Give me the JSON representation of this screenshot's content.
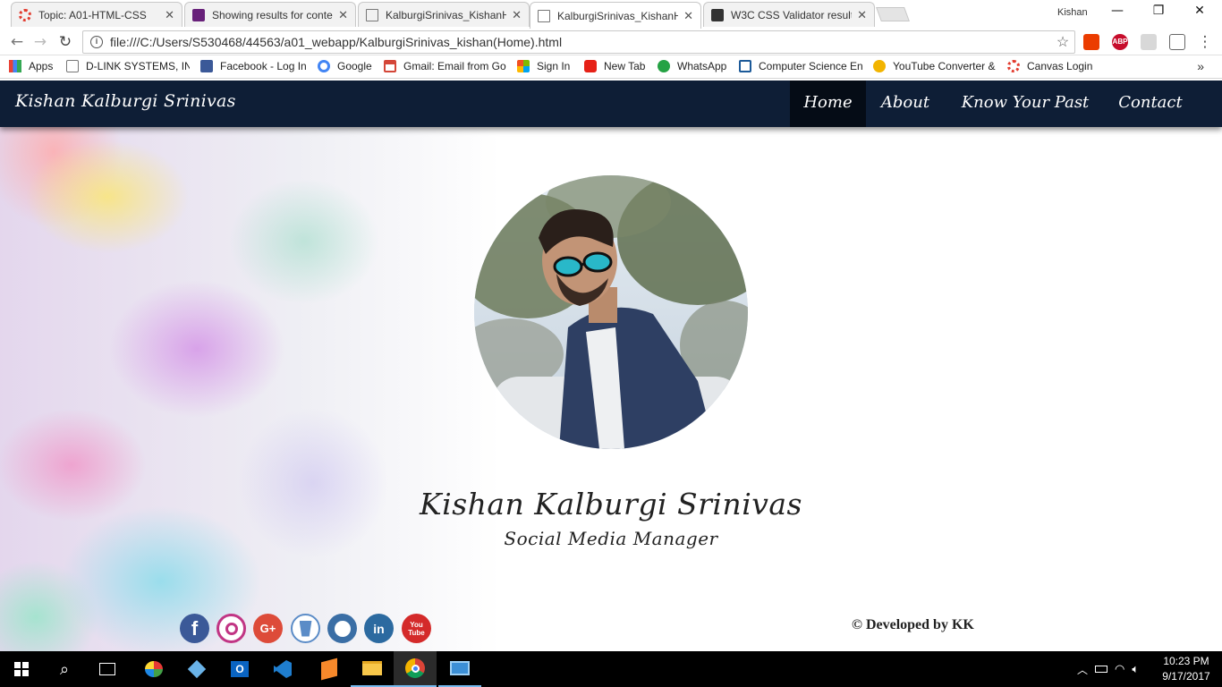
{
  "browser": {
    "tabs": [
      {
        "title": "Topic: A01-HTML-CSS",
        "icon": "canvas-icon",
        "active": false
      },
      {
        "title": "Showing results for conte",
        "icon": "vs-icon",
        "active": false
      },
      {
        "title": "KalburgiSrinivas_KishanH",
        "icon": "page-icon",
        "active": false
      },
      {
        "title": "KalburgiSrinivas_KishanH",
        "icon": "page-icon",
        "active": true
      },
      {
        "title": "W3C CSS Validator result",
        "icon": "w3c-icon",
        "active": false
      }
    ],
    "profile_name": "Kishan",
    "url": "file:///C:/Users/S530468/44563/a01_webapp/KalburgiSrinivas_kishan(Home).html",
    "extensions": [
      {
        "name": "office-icon",
        "label": "",
        "color": "#eb3c00"
      },
      {
        "name": "adblock-icon",
        "label": "ABP",
        "color": "#c70d2c"
      },
      {
        "name": "pdf-icon",
        "label": "",
        "color": "#bfbfbf"
      },
      {
        "name": "cast-icon",
        "label": "",
        "color": "#666666"
      }
    ],
    "bookmarks": [
      {
        "label": "Apps",
        "icon": "apps-grid-icon"
      },
      {
        "label": "D-LINK SYSTEMS, INC",
        "icon": "page-icon"
      },
      {
        "label": "Facebook - Log In",
        "icon": "facebook-icon"
      },
      {
        "label": "Google",
        "icon": "google-icon"
      },
      {
        "label": "Gmail: Email from Go",
        "icon": "gmail-icon"
      },
      {
        "label": "Sign In",
        "icon": "microsoft-icon"
      },
      {
        "label": "New Tab",
        "icon": "youtube-icon"
      },
      {
        "label": "WhatsApp",
        "icon": "whatsapp-icon"
      },
      {
        "label": "Computer Science En",
        "icon": "s-icon"
      },
      {
        "label": "YouTube Converter &",
        "icon": "converter-icon"
      },
      {
        "label": "Canvas Login",
        "icon": "canvas-icon"
      }
    ],
    "bookmarks_overflow": "»"
  },
  "site": {
    "brand": "Kishan Kalburgi Srinivas",
    "nav": [
      {
        "label": "Home",
        "active": true
      },
      {
        "label": "About",
        "active": false
      },
      {
        "label": "Know Your Past",
        "active": false
      },
      {
        "label": "Contact",
        "active": false
      }
    ],
    "hero": {
      "name": "Kishan Kalburgi Srinivas",
      "role": "Social Media Manager"
    },
    "social_links": [
      {
        "name": "facebook-link",
        "glyph": "f",
        "color": "#3b5998"
      },
      {
        "name": "instagram-link",
        "glyph": "◎",
        "color": "#c13584"
      },
      {
        "name": "google-plus-link",
        "glyph": "G+",
        "color": "#dd4b39"
      },
      {
        "name": "bitbucket-link",
        "glyph": "▼",
        "color": "#5b8cc7"
      },
      {
        "name": "github-link",
        "glyph": "◉",
        "color": "#3a6ea5"
      },
      {
        "name": "linkedin-link",
        "glyph": "in",
        "color": "#2c6aa0"
      },
      {
        "name": "youtube-link",
        "glyph": "You\nTube",
        "color": "#d42a2a"
      }
    ],
    "footer_credit": "© Developed by KK"
  },
  "taskbar": {
    "apps": [
      {
        "name": "start-icon"
      },
      {
        "name": "search-icon"
      },
      {
        "name": "task-view-icon"
      },
      {
        "name": "paint-icon"
      },
      {
        "name": "cube-3d-icon"
      },
      {
        "name": "outlook-icon"
      },
      {
        "name": "visual-studio-code-icon"
      },
      {
        "name": "sublime-icon"
      },
      {
        "name": "file-explorer-icon"
      },
      {
        "name": "chrome-icon"
      },
      {
        "name": "remote-desktop-icon"
      }
    ],
    "clock_time": "10:23 PM",
    "clock_date": "9/17/2017"
  }
}
